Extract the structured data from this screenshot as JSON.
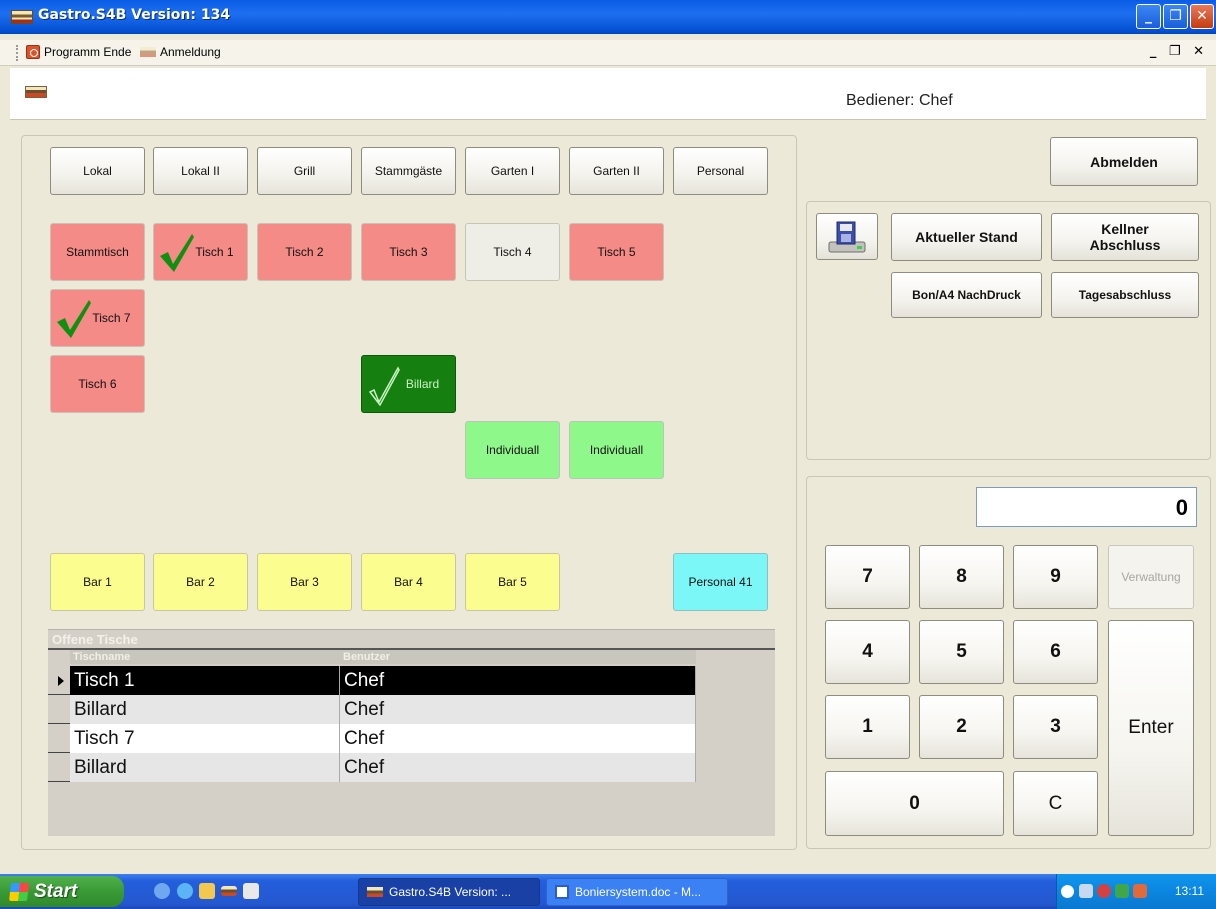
{
  "window": {
    "title": "Gastro.S4B Version: 134"
  },
  "menu": {
    "items": [
      "Programm Ende",
      "Anmeldung"
    ],
    "mdi_controls": "_ Œ ×"
  },
  "header": {
    "operator": "Bediener: Chef"
  },
  "areas": [
    "Lokal",
    "Lokal II",
    "Grill",
    "Stammgäste",
    "Garten I",
    "Garten II",
    "Personal"
  ],
  "tables": [
    {
      "label": "Stammtisch",
      "status": "red"
    },
    {
      "label": "Tisch  1",
      "status": "red",
      "checked": true
    },
    {
      "label": "Tisch  2",
      "status": "red"
    },
    {
      "label": "Tisch 3",
      "status": "red"
    },
    {
      "label": "Tisch  4",
      "status": "free"
    },
    {
      "label": "Tisch  5",
      "status": "red"
    },
    {
      "label": "Tisch 7",
      "status": "red",
      "checked": true
    },
    {
      "label": "Tisch 6",
      "status": "red"
    },
    {
      "label": "Billard",
      "status": "dark-green",
      "checked": true
    },
    {
      "label": "Individuall",
      "status": "green"
    },
    {
      "label": "Individuall",
      "status": "green"
    }
  ],
  "bars": [
    "Bar 1",
    "Bar 2",
    "Bar 3",
    "Bar 4",
    "Bar 5"
  ],
  "personal_button": "Personal 41",
  "open_tables": {
    "caption": "Offene Tische",
    "columns": [
      "Tischname",
      "Benutzer"
    ],
    "rows": [
      {
        "name": "Tisch  1",
        "user": "Chef"
      },
      {
        "name": "Billard",
        "user": "Chef"
      },
      {
        "name": "Tisch 7",
        "user": "Chef"
      },
      {
        "name": "Billard",
        "user": "Chef"
      }
    ]
  },
  "actions": {
    "logout": "Abmelden",
    "current_status": "Aktueller Stand",
    "waiter_close": "Kellner Abschluss",
    "reprint": "Bon/A4 NachDruck",
    "daily_close": "Tagesabschluss"
  },
  "keypad": {
    "display": "0",
    "keys": [
      "7",
      "8",
      "9",
      "4",
      "5",
      "6",
      "1",
      "2",
      "3",
      "0",
      "C"
    ],
    "admin": "Verwaltung",
    "enter": "Enter"
  },
  "taskbar": {
    "start": "Start",
    "tasks": [
      "Gastro.S4B Version: ...",
      "Boniersystem.doc - M..."
    ],
    "clock": "13:11"
  },
  "colors": {
    "occupied": "#f48b87",
    "free": "#efeee6",
    "green": "#8ef88b",
    "dark_green": "#15800f",
    "bar": "#fcfd8f",
    "personal": "#7cf7f7"
  }
}
